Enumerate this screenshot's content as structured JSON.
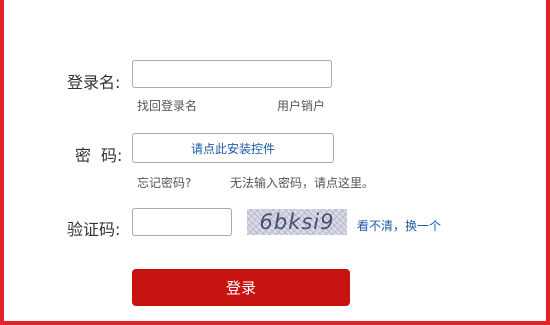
{
  "colors": {
    "frame": "#e4222a",
    "login_button": "#c7130f",
    "link": "#1c5aa6"
  },
  "username": {
    "label": "登录名:",
    "value": ""
  },
  "links_row1": {
    "find_login_name": "找回登录名",
    "cancel_account": "用户销户"
  },
  "password": {
    "label_char1": "密",
    "label_char2": "码:",
    "control_link": "请点此安装控件"
  },
  "links_row2": {
    "forgot_password": "忘记密码?",
    "cannot_input": "无法输入密码，请点这里。"
  },
  "captcha": {
    "label": "验证码:",
    "value": "",
    "image_text": "6bksi9",
    "refresh_link": "看不清，换一个"
  },
  "submit": {
    "label": "登录"
  }
}
